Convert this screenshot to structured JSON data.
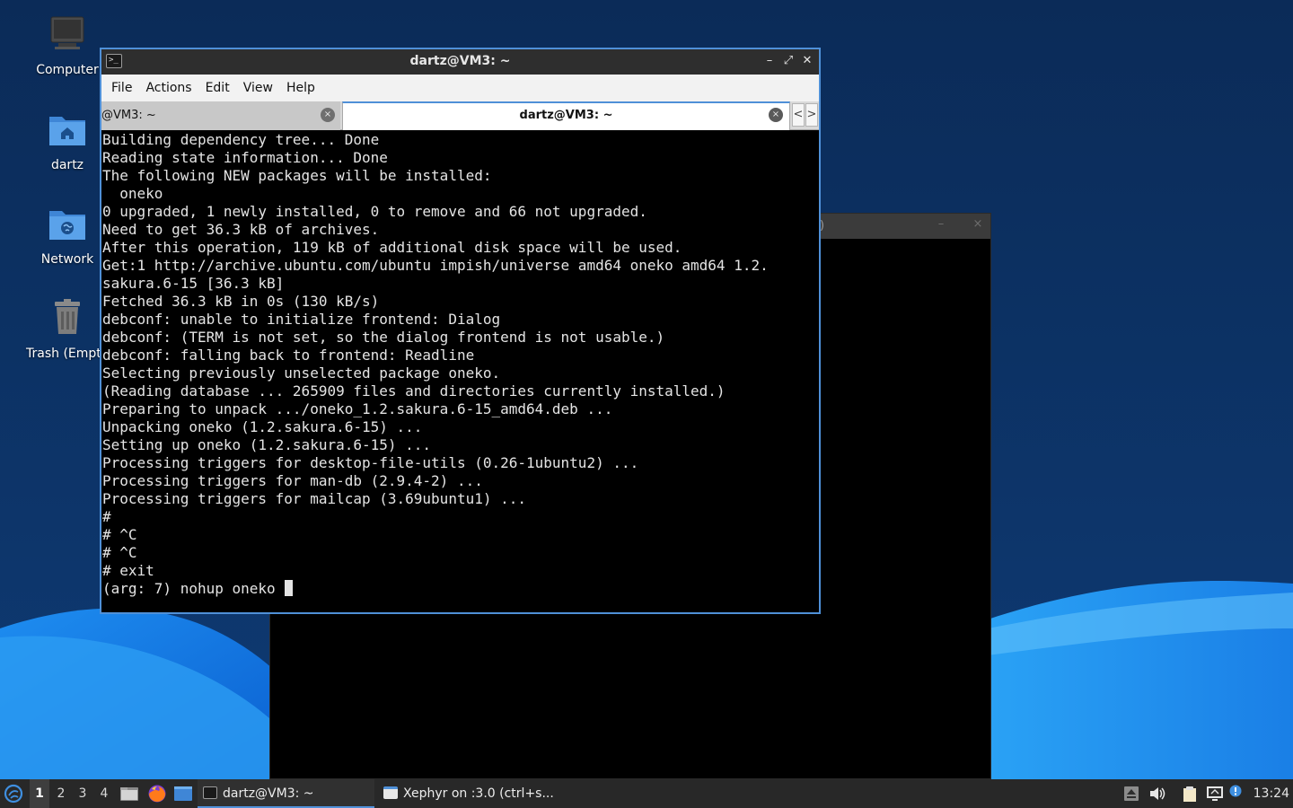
{
  "desktop": {
    "icons": [
      {
        "label": "Computer",
        "icon": "computer-icon"
      },
      {
        "label": "dartz",
        "icon": "home-folder-icon"
      },
      {
        "label": "Network",
        "icon": "network-folder-icon"
      },
      {
        "label": "Trash (Empt",
        "icon": "trash-icon"
      }
    ]
  },
  "xephyr_window": {
    "title": ")",
    "minimize": "–",
    "close": "×"
  },
  "terminal": {
    "title": "dartz@VM3: ~",
    "menu": [
      "File",
      "Actions",
      "Edit",
      "View",
      "Help"
    ],
    "tabs": [
      {
        "label": "@VM3: ~",
        "active": false
      },
      {
        "label": "dartz@VM3: ~",
        "active": true
      }
    ],
    "tab_close": "×",
    "tab_prev": "<",
    "tab_next": ">",
    "window_buttons": {
      "minimize": "–",
      "maximize": "⤢",
      "close": "✕"
    },
    "lines": [
      "Building dependency tree... Done",
      "Reading state information... Done",
      "The following NEW packages will be installed:",
      "  oneko",
      "0 upgraded, 1 newly installed, 0 to remove and 66 not upgraded.",
      "Need to get 36.3 kB of archives.",
      "After this operation, 119 kB of additional disk space will be used.",
      "Get:1 http://archive.ubuntu.com/ubuntu impish/universe amd64 oneko amd64 1.2.",
      "sakura.6-15 [36.3 kB]",
      "Fetched 36.3 kB in 0s (130 kB/s)",
      "debconf: unable to initialize frontend: Dialog",
      "debconf: (TERM is not set, so the dialog frontend is not usable.)",
      "debconf: falling back to frontend: Readline",
      "Selecting previously unselected package oneko.",
      "(Reading database ... 265909 files and directories currently installed.)",
      "Preparing to unpack .../oneko_1.2.sakura.6-15_amd64.deb ...",
      "Unpacking oneko (1.2.sakura.6-15) ...",
      "Setting up oneko (1.2.sakura.6-15) ...",
      "Processing triggers for desktop-file-utils (0.26-1ubuntu2) ...",
      "Processing triggers for man-db (2.9.4-2) ...",
      "Processing triggers for mailcap (3.69ubuntu1) ...",
      "#",
      "# ^C",
      "# ^C",
      "# exit"
    ],
    "prompt_line": "(arg: 7) nohup oneko "
  },
  "taskbar": {
    "start_icon": "lubuntu-start-icon",
    "workspaces": [
      "1",
      "2",
      "3",
      "4"
    ],
    "active_workspace": "1",
    "launchers": [
      "file-manager-icon",
      "firefox-icon",
      "show-desktop-icon"
    ],
    "tasks": [
      {
        "label": "dartz@VM3: ~",
        "icon": "terminal-icon",
        "active": true
      },
      {
        "label": "Xephyr on :3.0 (ctrl+s...",
        "icon": "xephyr-window-icon",
        "active": false
      }
    ],
    "tray": [
      "eject-icon",
      "volume-icon",
      "clipboard-icon",
      "network-icon",
      "update-notifier-icon"
    ],
    "clock": "13:24"
  }
}
